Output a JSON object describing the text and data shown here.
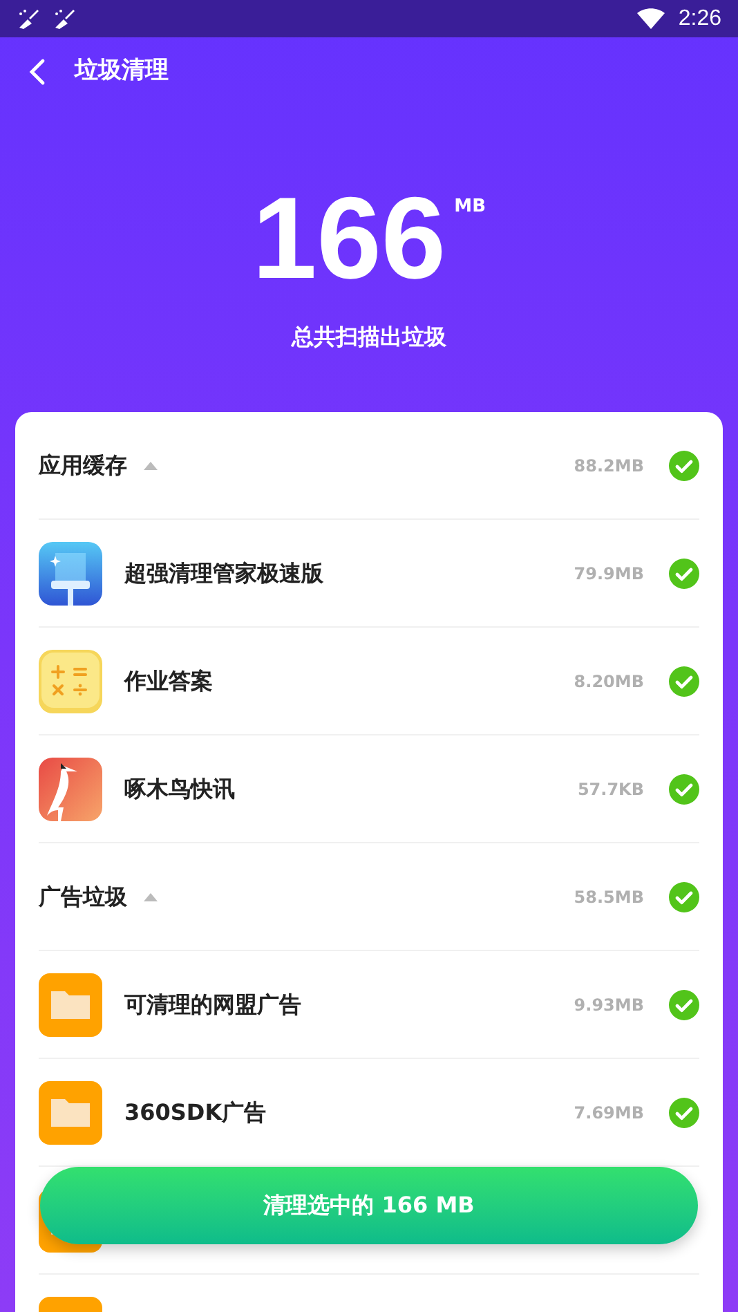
{
  "status_bar": {
    "time": "2:26"
  },
  "header": {
    "title": "垃圾清理"
  },
  "summary": {
    "amount": "166",
    "unit": "MB",
    "caption": "总共扫描出垃圾"
  },
  "sections": [
    {
      "name": "应用缓存",
      "size": "88.2MB",
      "expanded": true,
      "checked": true,
      "items": [
        {
          "kind": "cleaner",
          "name": "超强清理管家极速版",
          "size": "79.9MB",
          "checked": true
        },
        {
          "kind": "calculator",
          "name": "作业答案",
          "size": "8.20MB",
          "checked": true
        },
        {
          "kind": "bird",
          "name": "啄木鸟快讯",
          "size": "57.7KB",
          "checked": true
        }
      ]
    },
    {
      "name": "广告垃圾",
      "size": "58.5MB",
      "expanded": true,
      "checked": true,
      "items": [
        {
          "kind": "folder",
          "name": "可清理的网盟广告",
          "size": "9.93MB",
          "checked": true
        },
        {
          "kind": "folder",
          "name": "360SDK广告",
          "size": "7.69MB",
          "checked": true
        },
        {
          "kind": "folder"
        },
        {
          "kind": "folder"
        }
      ]
    }
  ],
  "clean_button": {
    "label": "清理选中的 166 MB"
  }
}
